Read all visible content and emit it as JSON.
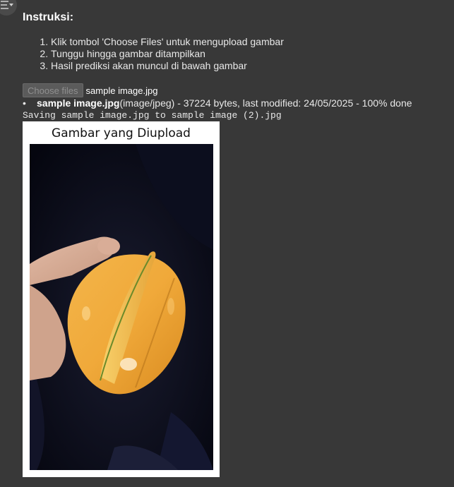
{
  "instructions": {
    "heading": "Instruksi:",
    "steps": [
      "Klik tombol 'Choose Files' untuk mengupload gambar",
      "Tunggu hingga gambar ditampilkan",
      "Hasil prediksi akan muncul di bawah gambar"
    ]
  },
  "upload": {
    "button_label": "Choose files",
    "selected_filename": "sample image.jpg",
    "file_name": "sample image.jpg",
    "file_meta": "(image/jpeg) - 37224 bytes, last modified: 24/05/2025 - 100% done"
  },
  "output": {
    "saving_message": "Saving sample image.jpg to sample image (2).jpg"
  },
  "figure": {
    "title": "Gambar yang Diupload",
    "image_subject": "star fruit held in hand"
  },
  "colors": {
    "background": "#383838",
    "text": "#e6e6e6",
    "figure_bg": "#ffffff"
  },
  "icons": {
    "output_toggle": "output-toggle-icon"
  }
}
